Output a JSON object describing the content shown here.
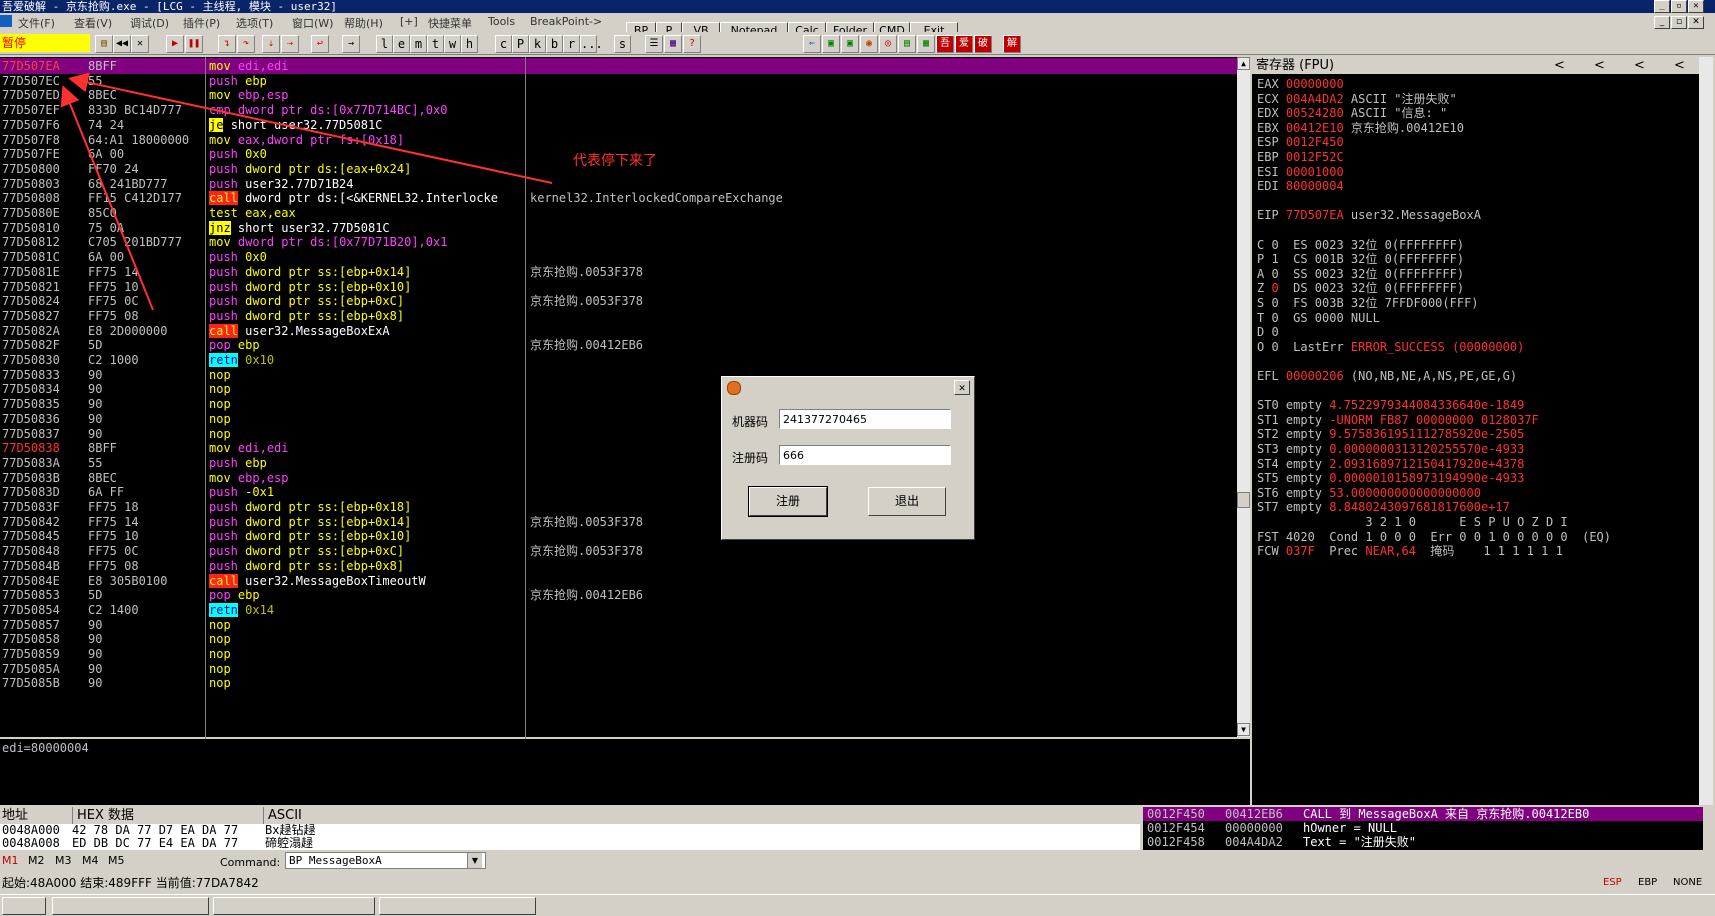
{
  "window": {
    "title": "吾爱破解 - 京东抢购.exe - [LCG - 主线程, 模块 - user32]"
  },
  "menu": {
    "items": [
      "文件(F)",
      "查看(V)",
      "调试(D)",
      "插件(P)",
      "选项(T)",
      "窗口(W)",
      "帮助(H)",
      "[+]",
      "快捷菜单",
      "Tools",
      "BreakPoint->"
    ],
    "tool_buttons": [
      "BP",
      "P",
      "VB",
      "Notepad",
      "Calc",
      "Folder",
      "CMD",
      "Exit"
    ]
  },
  "toolbar": {
    "status": "暂停",
    "letters": [
      "l",
      "e",
      "m",
      "t",
      "w",
      "h",
      "c",
      "P",
      "k",
      "b",
      "r",
      "...",
      "s"
    ]
  },
  "disasm": {
    "rows": [
      {
        "addr": "77D507EA",
        "hex": "8BFF",
        "asm": "mov edi,edi",
        "cmt": "",
        "sel": true
      },
      {
        "addr": "77D507EC",
        "hex": "55",
        "asm": "push ebp",
        "cmt": ""
      },
      {
        "addr": "77D507ED",
        "hex": "8BEC",
        "asm": "mov ebp,esp",
        "cmt": ""
      },
      {
        "addr": "77D507EF",
        "hex": "833D BC14D777",
        "asm": "cmp dword ptr ds:[0x77D714BC],0x0",
        "cmt": ""
      },
      {
        "addr": "77D507F6",
        "hex": "74 24",
        "asm": "je short user32.77D5081C",
        "cmt": ""
      },
      {
        "addr": "77D507F8",
        "hex": "64:A1 18000000",
        "asm": "mov eax,dword ptr fs:[0x18]",
        "cmt": ""
      },
      {
        "addr": "77D507FE",
        "hex": "6A 00",
        "asm": "push 0x0",
        "cmt": ""
      },
      {
        "addr": "77D50800",
        "hex": "FF70 24",
        "asm": "push dword ptr ds:[eax+0x24]",
        "cmt": ""
      },
      {
        "addr": "77D50803",
        "hex": "68 241BD777",
        "asm": "push user32.77D71B24",
        "cmt": ""
      },
      {
        "addr": "77D50808",
        "hex": "FF15 C412D177",
        "asm": "call dword ptr ds:[<&KERNEL32.Interlocke",
        "cmt": "kernel32.InterlockedCompareExchange"
      },
      {
        "addr": "77D5080E",
        "hex": "85C0",
        "asm": "test eax,eax",
        "cmt": ""
      },
      {
        "addr": "77D50810",
        "hex": "75 0A",
        "asm": "jnz short user32.77D5081C",
        "cmt": ""
      },
      {
        "addr": "77D50812",
        "hex": "C705 201BD777",
        "asm": "mov dword ptr ds:[0x77D71B20],0x1",
        "cmt": ""
      },
      {
        "addr": "77D5081C",
        "hex": "6A 00",
        "asm": "push 0x0",
        "cmt": ""
      },
      {
        "addr": "77D5081E",
        "hex": "FF75 14",
        "asm": "push dword ptr ss:[ebp+0x14]",
        "cmt": "京东抢购.0053F378"
      },
      {
        "addr": "77D50821",
        "hex": "FF75 10",
        "asm": "push dword ptr ss:[ebp+0x10]",
        "cmt": ""
      },
      {
        "addr": "77D50824",
        "hex": "FF75 0C",
        "asm": "push dword ptr ss:[ebp+0xC]",
        "cmt": "京东抢购.0053F378"
      },
      {
        "addr": "77D50827",
        "hex": "FF75 08",
        "asm": "push dword ptr ss:[ebp+0x8]",
        "cmt": ""
      },
      {
        "addr": "77D5082A",
        "hex": "E8 2D000000",
        "asm": "call user32.MessageBoxExA",
        "cmt": ""
      },
      {
        "addr": "77D5082F",
        "hex": "5D",
        "asm": "pop ebp",
        "cmt": "京东抢购.00412EB6"
      },
      {
        "addr": "77D50830",
        "hex": "C2 1000",
        "asm": "retn 0x10",
        "cmt": ""
      },
      {
        "addr": "77D50833",
        "hex": "90",
        "asm": "nop",
        "cmt": ""
      },
      {
        "addr": "77D50834",
        "hex": "90",
        "asm": "nop",
        "cmt": ""
      },
      {
        "addr": "77D50835",
        "hex": "90",
        "asm": "nop",
        "cmt": ""
      },
      {
        "addr": "77D50836",
        "hex": "90",
        "asm": "nop",
        "cmt": ""
      },
      {
        "addr": "77D50837",
        "hex": "90",
        "asm": "nop",
        "cmt": ""
      },
      {
        "addr": "77D50838",
        "hex": "8BFF",
        "asm": "mov edi,edi",
        "cmt": "",
        "red": true
      },
      {
        "addr": "77D5083A",
        "hex": "55",
        "asm": "push ebp",
        "cmt": ""
      },
      {
        "addr": "77D5083B",
        "hex": "8BEC",
        "asm": "mov ebp,esp",
        "cmt": ""
      },
      {
        "addr": "77D5083D",
        "hex": "6A FF",
        "asm": "push -0x1",
        "cmt": ""
      },
      {
        "addr": "77D5083F",
        "hex": "FF75 18",
        "asm": "push dword ptr ss:[ebp+0x18]",
        "cmt": ""
      },
      {
        "addr": "77D50842",
        "hex": "FF75 14",
        "asm": "push dword ptr ss:[ebp+0x14]",
        "cmt": "京东抢购.0053F378"
      },
      {
        "addr": "77D50845",
        "hex": "FF75 10",
        "asm": "push dword ptr ss:[ebp+0x10]",
        "cmt": ""
      },
      {
        "addr": "77D50848",
        "hex": "FF75 0C",
        "asm": "push dword ptr ss:[ebp+0xC]",
        "cmt": "京东抢购.0053F378"
      },
      {
        "addr": "77D5084B",
        "hex": "FF75 08",
        "asm": "push dword ptr ss:[ebp+0x8]",
        "cmt": ""
      },
      {
        "addr": "77D5084E",
        "hex": "E8 305B0100",
        "asm": "call user32.MessageBoxTimeoutW",
        "cmt": ""
      },
      {
        "addr": "77D50853",
        "hex": "5D",
        "asm": "pop ebp",
        "cmt": "京东抢购.00412EB6"
      },
      {
        "addr": "77D50854",
        "hex": "C2 1400",
        "asm": "retn 0x14",
        "cmt": ""
      },
      {
        "addr": "77D50857",
        "hex": "90",
        "asm": "nop",
        "cmt": ""
      },
      {
        "addr": "77D50858",
        "hex": "90",
        "asm": "nop",
        "cmt": ""
      },
      {
        "addr": "77D50859",
        "hex": "90",
        "asm": "nop",
        "cmt": ""
      },
      {
        "addr": "77D5085A",
        "hex": "90",
        "asm": "nop",
        "cmt": ""
      },
      {
        "addr": "77D5085B",
        "hex": "90",
        "asm": "nop",
        "cmt": ""
      }
    ],
    "annotation": "代表停下来了",
    "info_line": "edi=80000004"
  },
  "registers": {
    "header": "寄存器 (FPU)",
    "nav": [
      "<",
      "<",
      "<",
      "<"
    ],
    "lines": [
      [
        {
          "t": "EAX "
        },
        {
          "t": "00000000",
          "c": "red"
        }
      ],
      [
        {
          "t": "ECX "
        },
        {
          "t": "004A4DA2",
          "c": "red"
        },
        {
          "t": " ASCII \"注册失败\""
        }
      ],
      [
        {
          "t": "EDX "
        },
        {
          "t": "00524280",
          "c": "red"
        },
        {
          "t": " ASCII \"信息: \""
        }
      ],
      [
        {
          "t": "EBX "
        },
        {
          "t": "00412E10",
          "c": "red"
        },
        {
          "t": " 京东抢购.00412E10"
        }
      ],
      [
        {
          "t": "ESP "
        },
        {
          "t": "0012F450",
          "c": "red"
        }
      ],
      [
        {
          "t": "EBP "
        },
        {
          "t": "0012F52C",
          "c": "red"
        }
      ],
      [
        {
          "t": "ESI "
        },
        {
          "t": "00001000",
          "c": "red"
        }
      ],
      [
        {
          "t": "EDI "
        },
        {
          "t": "80000004",
          "c": "red"
        }
      ],
      [],
      [
        {
          "t": "EIP "
        },
        {
          "t": "77D507EA",
          "c": "red"
        },
        {
          "t": " user32.MessageBoxA"
        }
      ],
      [],
      [
        {
          "t": "C 0  ES 0023 32位 0(FFFFFFFF)"
        }
      ],
      [
        {
          "t": "P 1  CS 001B 32位 0(FFFFFFFF)"
        }
      ],
      [
        {
          "t": "A 0  SS 0023 32位 0(FFFFFFFF)"
        }
      ],
      [
        {
          "t": "Z "
        },
        {
          "t": "0",
          "c": "red"
        },
        {
          "t": "  DS 0023 32位 0(FFFFFFFF)"
        }
      ],
      [
        {
          "t": "S 0  FS 003B 32位 7FFDF000(FFF)"
        }
      ],
      [
        {
          "t": "T 0  GS 0000 NULL"
        }
      ],
      [
        {
          "t": "D 0"
        }
      ],
      [
        {
          "t": "O 0  LastErr "
        },
        {
          "t": "ERROR_SUCCESS (00000000)",
          "c": "red"
        }
      ],
      [],
      [
        {
          "t": "EFL "
        },
        {
          "t": "00000206",
          "c": "red"
        },
        {
          "t": " (NO,NB,NE,A,NS,PE,GE,G)"
        }
      ],
      [],
      [
        {
          "t": "ST0 empty "
        },
        {
          "t": "4.7522979344084336640e-1849",
          "c": "red"
        }
      ],
      [
        {
          "t": "ST1 empty "
        },
        {
          "t": "-UNORM FB87 00000000 0128037F",
          "c": "red"
        }
      ],
      [
        {
          "t": "ST2 empty "
        },
        {
          "t": "9.5758361951112785920e-2505",
          "c": "red"
        }
      ],
      [
        {
          "t": "ST3 empty "
        },
        {
          "t": "0.0000000313120255570e-4933",
          "c": "red"
        }
      ],
      [
        {
          "t": "ST4 empty "
        },
        {
          "t": "2.0931689712150417920e+4378",
          "c": "red"
        }
      ],
      [
        {
          "t": "ST5 empty "
        },
        {
          "t": "0.0000010158973194990e-4933",
          "c": "red"
        }
      ],
      [
        {
          "t": "ST6 empty "
        },
        {
          "t": "53.000000000000000000",
          "c": "red"
        }
      ],
      [
        {
          "t": "ST7 empty "
        },
        {
          "t": "8.8480243097681817600e+17",
          "c": "red"
        }
      ],
      [
        {
          "t": "               3 2 1 0      E S P U O Z D I"
        }
      ],
      [
        {
          "t": "FST 4020  Cond 1 0 0 0  Err 0 0 1 0 0 0 0 0  (EQ)"
        }
      ],
      [
        {
          "t": "FCW "
        },
        {
          "t": "037F",
          "c": "red"
        },
        {
          "t": "  Prec "
        },
        {
          "t": "NEAR,64",
          "c": "red"
        },
        {
          "t": "  掩码    1 1 1 1 1 1"
        }
      ]
    ]
  },
  "dump": {
    "headers": [
      "地址",
      "HEX 数据",
      "ASCII"
    ],
    "rows": [
      {
        "addr": "0048A000",
        "hex": "42 78 DA 77 D7 EA DA 77",
        "ascii": "Bx趢钻趢"
      },
      {
        "addr": "0048A008",
        "hex": "ED DB DC 77 E4 EA DA 77",
        "ascii": "碲躻溻趢"
      }
    ]
  },
  "stack": {
    "rows": [
      {
        "addr": "0012F450",
        "val": "00412EB6",
        "cmt": "CALL 到 MessageBoxA 来自 京东抢购.00412EB0",
        "sel": true
      },
      {
        "addr": "0012F454",
        "val": "00000000",
        "cmt": "hOwner = NULL"
      },
      {
        "addr": "0012F458",
        "val": "004A4DA2",
        "cmt": "Text = \"注册失败\""
      }
    ]
  },
  "command": {
    "tabs": [
      "M1",
      "M2",
      "M3",
      "M4",
      "M5"
    ],
    "label": "Command:",
    "value": "BP  MessageBoxA"
  },
  "status": {
    "text": "起始:48A000 结束:489FFF 当前值:77DA7842",
    "right": [
      "ESP",
      "EBP",
      "NONE"
    ]
  },
  "dialog": {
    "machine_label": "机器码",
    "machine_value": "241377270465",
    "reg_label": "注册码",
    "reg_value": "666",
    "register_button": "注册",
    "exit_button": "退出"
  },
  "colors": {
    "accent_red": "#ff3030",
    "push": "#ff40ff",
    "mov": "#ffff00",
    "call_bg": "#ff2020",
    "retn_bg": "#00ffff",
    "selection": "#800080"
  }
}
